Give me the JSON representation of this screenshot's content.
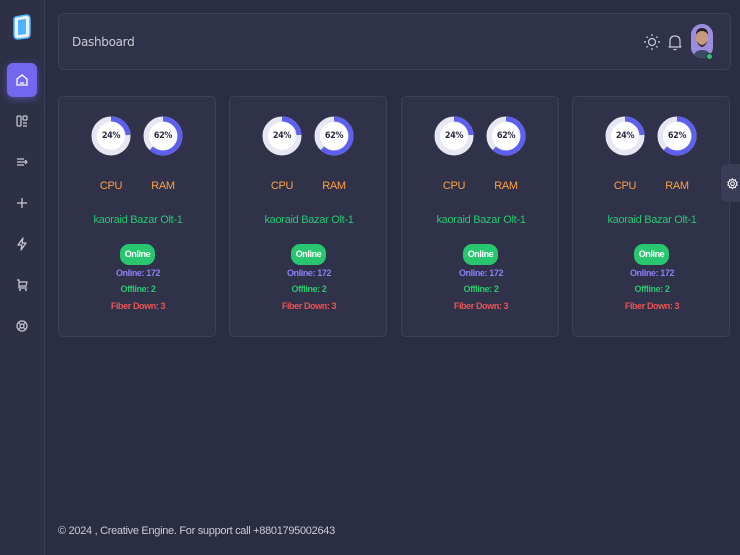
{
  "header": {
    "title": "Dashboard"
  },
  "sidebar": {
    "items": [
      {
        "icon": "home-icon",
        "active": true
      },
      {
        "icon": "layout-icon",
        "active": false
      },
      {
        "icon": "list-arrow-icon",
        "active": false
      },
      {
        "icon": "plus-icon",
        "active": false
      },
      {
        "icon": "bolt-icon",
        "active": false
      },
      {
        "icon": "cart-icon",
        "active": false
      },
      {
        "icon": "lifebuoy-icon",
        "active": false
      }
    ]
  },
  "devices": [
    {
      "cpu_label": "CPU",
      "ram_label": "RAM",
      "cpu": "24%",
      "ram": "62%",
      "cpu_fraction": 0.24,
      "ram_fraction": 0.62,
      "name": "kaoraid Bazar Olt-1",
      "status": "Online",
      "online": "Online: 172",
      "offline": "Offline: 2",
      "fiber_down": "Fiber Down: 3"
    },
    {
      "cpu_label": "CPU",
      "ram_label": "RAM",
      "cpu": "24%",
      "ram": "62%",
      "cpu_fraction": 0.24,
      "ram_fraction": 0.62,
      "name": "kaoraid Bazar Olt-1",
      "status": "Online",
      "online": "Online: 172",
      "offline": "Offline: 2",
      "fiber_down": "Fiber Down: 3"
    },
    {
      "cpu_label": "CPU",
      "ram_label": "RAM",
      "cpu": "24%",
      "ram": "62%",
      "cpu_fraction": 0.24,
      "ram_fraction": 0.62,
      "name": "kaoraid Bazar Olt-1",
      "status": "Online",
      "online": "Online: 172",
      "offline": "Offline: 2",
      "fiber_down": "Fiber Down: 3"
    },
    {
      "cpu_label": "CPU",
      "ram_label": "RAM",
      "cpu": "24%",
      "ram": "62%",
      "cpu_fraction": 0.24,
      "ram_fraction": 0.62,
      "name": "kaoraid Bazar Olt-1",
      "status": "Online",
      "online": "Online: 172",
      "offline": "Offline: 2",
      "fiber_down": "Fiber Down: 3"
    }
  ],
  "footer": {
    "text": "© 2024 , Creative Engine. For support call +8801795002643"
  },
  "colors": {
    "accent": "#7367f0",
    "success": "#28c76f",
    "warning": "#ff9f43",
    "danger": "#ea5455",
    "gauge_track": "#e6e7f2",
    "gauge_fill": "#5d5fef"
  }
}
